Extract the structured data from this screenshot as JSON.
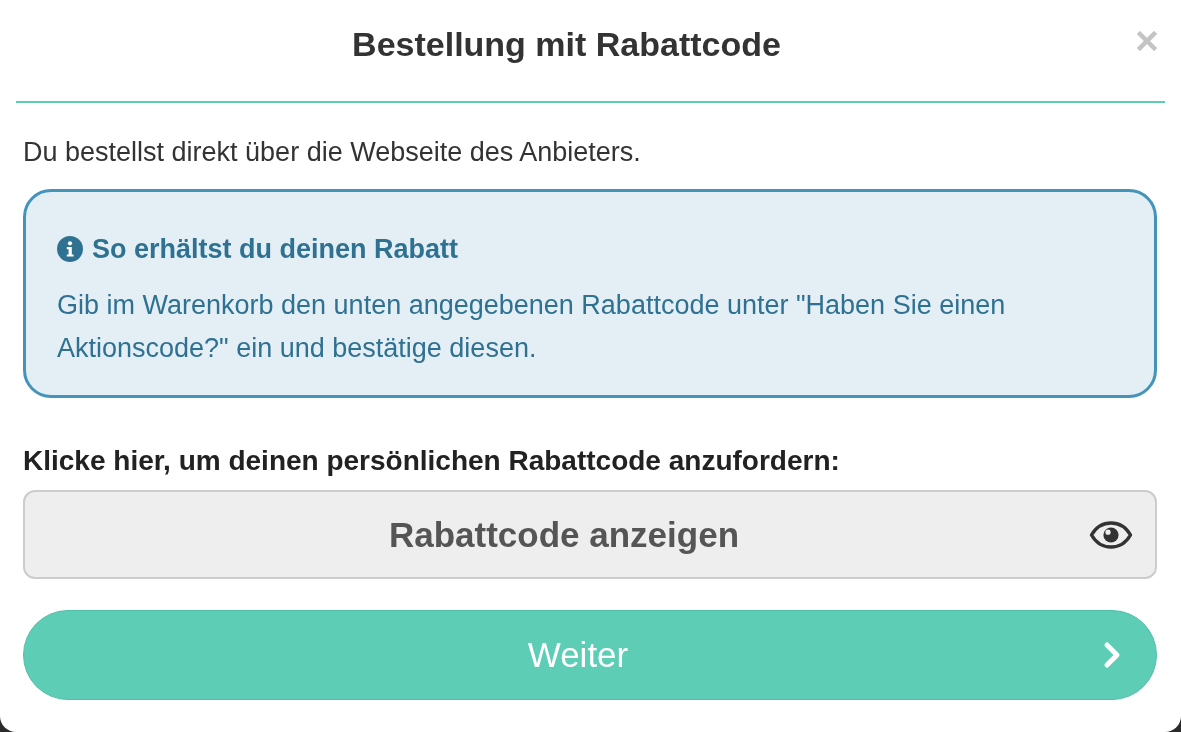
{
  "dialog": {
    "title": "Bestellung mit Rabattcode"
  },
  "intro": "Du bestellst direkt über die Webseite des Anbieters.",
  "info_box": {
    "heading": "So erhältst du deinen Rabatt",
    "text": "Gib im Warenkorb den unten angegebenen Rabattcode unter \"Haben Sie einen Aktionscode?\" ein und bestätige diesen."
  },
  "code_prompt": "Klicke hier, um deinen persönlichen Rabattcode anzufordern:",
  "reveal_button": {
    "label": "Rabattcode anzeigen"
  },
  "next_button": {
    "label": "Weiter"
  }
}
